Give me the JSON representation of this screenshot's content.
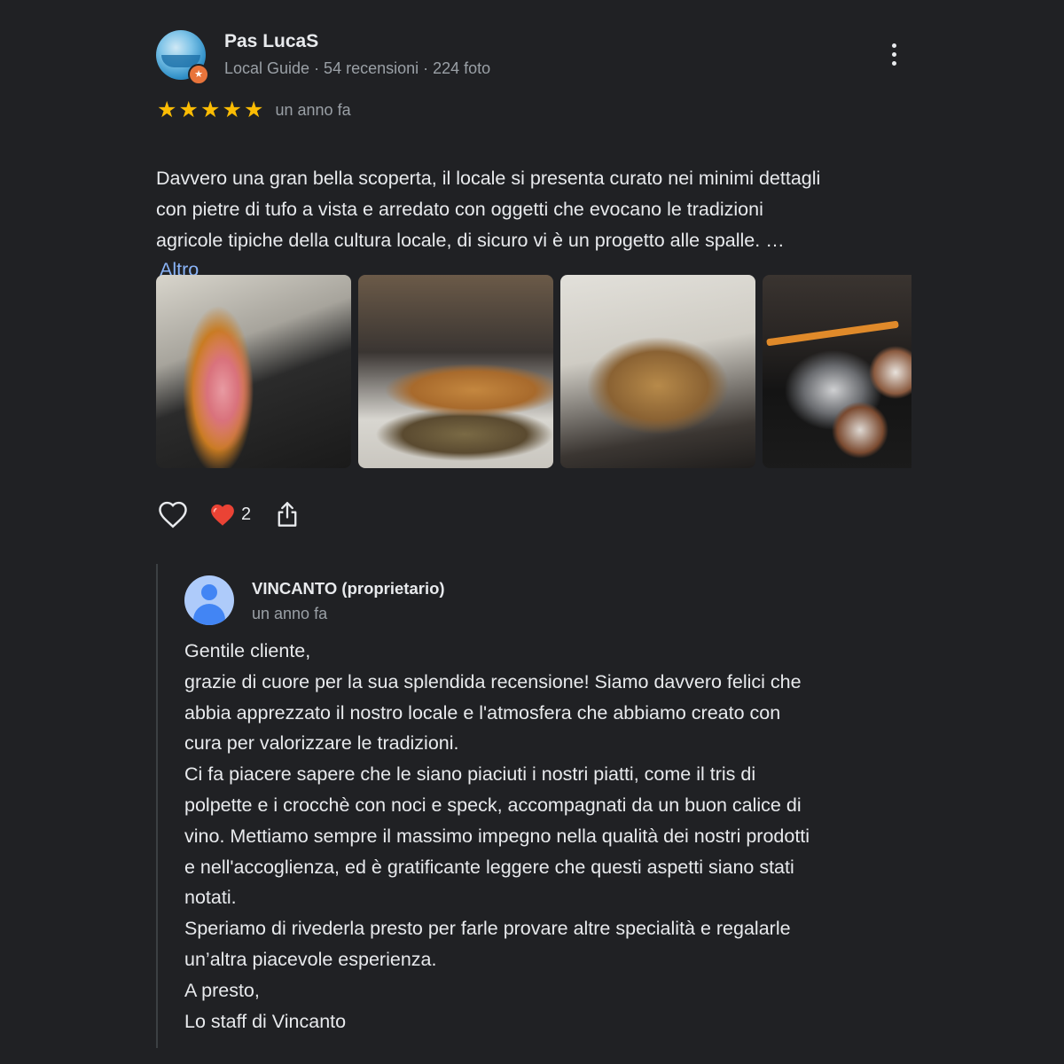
{
  "review": {
    "author_name": "Pas LucaS",
    "author_meta": "Local Guide · 54 recensioni · 224 foto",
    "rating": 5,
    "date": "un anno fa",
    "text_lines": [
      "Davvero una gran bella scoperta, il locale si presenta curato nei minimi dettagli",
      "con pietre di tufo a vista e arredato con oggetti che evocano le tradizioni",
      "agricole tipiche della cultura locale, di sicuro vi è un progetto alle spalle. …"
    ],
    "more_label": "Altro",
    "photos": [
      "photo-1",
      "photo-2",
      "photo-3",
      "photo-4"
    ],
    "reaction_count": "2",
    "icons": {
      "avatar": "avatar",
      "badge": "local-guide-badge-icon",
      "star": "star-icon",
      "menu": "more-vert-icon",
      "like": "heart-outline-icon",
      "reaction": "red-heart-icon",
      "share": "share-icon"
    },
    "colors": {
      "background": "#202124",
      "star": "#fbbc04",
      "link": "#8ab4f8",
      "secondary_text": "#9aa0a6",
      "reaction_heart": "#ea4335"
    }
  },
  "owner_reply": {
    "name": "VINCANTO (proprietario)",
    "date": "un anno fa",
    "text_lines": [
      "Gentile cliente,",
      "grazie di cuore per la sua splendida recensione! Siamo davvero felici che",
      "abbia apprezzato il nostro locale e l'atmosfera che abbiamo creato con",
      "cura per valorizzare le tradizioni.",
      "Ci fa piacere sapere che le siano piaciuti i nostri piatti, come il tris di",
      "polpette e i crocchè con noci e speck, accompagnati da un buon calice di",
      "vino. Mettiamo sempre il massimo impegno nella qualità dei nostri prodotti",
      "e nell'accoglienza, ed è gratificante leggere che questi aspetti siano stati",
      "notati.",
      "Speriamo di rivederla presto per farle provare altre specialità e regalarle",
      "un’altra piacevole esperienza.",
      "A presto,",
      "Lo staff di Vincanto"
    ]
  }
}
